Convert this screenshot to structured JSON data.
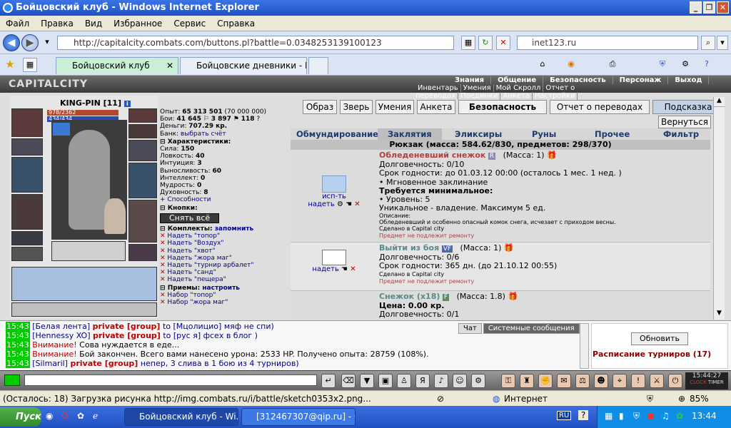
{
  "window": {
    "title": "Бойцовский клуб - Windows Internet Explorer"
  },
  "menu": [
    "Файл",
    "Правка",
    "Вид",
    "Избранное",
    "Сервис",
    "Справка"
  ],
  "address": {
    "url": "http://capitalcity.combats.com/buttons.pl?battle=0.0348253139100123",
    "search": "inet123.ru"
  },
  "tabs": [
    {
      "label": "Бойцовский клуб"
    },
    {
      "label": "Бойцовские дневники - KIN..."
    }
  ],
  "game": {
    "logo": "CAPITALCITY",
    "topnav": [
      "Знания",
      "Общение",
      "Безопасность",
      "Персонаж",
      "Выход"
    ],
    "subnav": [
      "Инвентарь",
      "Умения",
      "Мой Скролл",
      "Отчет о переводах",
      "Поединки",
      "Анкета",
      "Настройки"
    ],
    "char": {
      "name": "KING-PIN",
      "level": "[11]",
      "hp": "978/2362",
      "mana": "434/434"
    },
    "stats": {
      "exp_label": "Опыт:",
      "exp": "65 313 501",
      "exp_next": "(70 000 000)",
      "wins_label": "Бои:",
      "wins": "41 645",
      "losses": "3 897",
      "draws": "118",
      "money_label": "Деньги:",
      "money": "707.29 кр.",
      "bank_label": "Банк:",
      "bank": "выбрать счёт"
    },
    "chars_header": "Характеристики:",
    "attrs": [
      {
        "label": "Сила:",
        "value": "150"
      },
      {
        "label": "Ловкость:",
        "value": "40"
      },
      {
        "label": "Интуиция:",
        "value": "3"
      },
      {
        "label": "Выносливость:",
        "value": "60"
      },
      {
        "label": "Интеллект:",
        "value": "0"
      },
      {
        "label": "Мудрость:",
        "value": "0"
      },
      {
        "label": "Духовность:",
        "value": "8"
      }
    ],
    "abilities": "+ Способности",
    "buttons_header": "Кнопки:",
    "take_off_all": "Снять всё",
    "sets_header": "Комплекты:",
    "remember": "запомнить",
    "sets": [
      "Надеть \"топор\"",
      "Надеть \"Воздух\"",
      "Надеть \"хвот\"",
      "Надеть \"жора маг\"",
      "Надеть \"турнир арбалет\"",
      "Надеть \"санд\"",
      "Надеть \"пещера\""
    ],
    "tricks_header": "Приемы:",
    "configure": "настроить",
    "tricks": [
      "Набор \"топор\"",
      "Набор \"жора маг\""
    ],
    "action_buttons": [
      "Образ",
      "Зверь",
      "Умения",
      "Анкета",
      "Безопасность",
      "Отчет о переводах",
      "Подсказка"
    ],
    "back": "Вернуться",
    "categories": [
      "Обмундирование",
      "Заклятия",
      "Эликсиры",
      "Руны",
      "Прочее",
      "Фильтр"
    ],
    "inv_title": "Рюкзак (масса: 584.62/830, предметов: 298/370)",
    "items": [
      {
        "name": "Обледеневший снежок",
        "badge": "R",
        "mass": "(Масса: 1)",
        "use_label": "исп-ть",
        "wear_label": "надеть",
        "lines": [
          "Долговечность: 0/10",
          "Срок годности: до 01.03.12 00:00 (осталось 1 мес. 1 нед. )",
          "• Мгновенное заклинание"
        ],
        "req_header": "Требуется минимальное:",
        "req": [
          "• Уровень: 5"
        ],
        "unique": "Уникальное - владение. Максимум 5 ед.",
        "desc_label": "Описание:",
        "desc": "Обледеневший и особенно опасный комок снега, исчезает с приходом весны.",
        "made": "Сделано в Capital city",
        "norepair": "Предмет не подлежит ремонту"
      },
      {
        "name": "Выйти из боя",
        "badge": "VF",
        "mass": "(Масса: 1)",
        "wear_label": "надеть",
        "lines": [
          "Долговечность: 0/6",
          "Срок годности: 365 дн. (до 21.10.12 00:55)"
        ],
        "made": "Сделано в Capital city",
        "norepair": "Предмет не подлежит ремонту"
      },
      {
        "name": "Снежок (x18)",
        "badge": "F",
        "mass": "(Масса: 1.8)",
        "price": "Цена: 0.00 кр.",
        "lines": [
          "Долговечность: 0/1"
        ]
      }
    ]
  },
  "chat": {
    "tabs": [
      "Чат",
      "Системные сообщения"
    ],
    "lines": [
      {
        "time": "15:43",
        "name": "[Белая лента]",
        "mode": "private [group]",
        "rest": "to [Мцолицио] мяф не спи)"
      },
      {
        "time": "15:43",
        "name": "[Hennessy XO]",
        "mode": "private [group]",
        "rest": "to [рус я] фсех в блог )"
      },
      {
        "time": "15:43",
        "warn": "Внимание!",
        "rest": "Сова нуждается в еде..."
      },
      {
        "time": "15:43",
        "warn": "Внимание!",
        "rest": "Бой закончен. Всего вами нанесено урона: 2533 HP. Получено опыта: 28759 (108%)."
      },
      {
        "time": "15:43",
        "name": "[Silmaril]",
        "mode": "private [group]",
        "rest": "непер, 3 слива в 1 бою из 4 турниров)"
      }
    ],
    "refresh": "Обновить",
    "schedule": "Расписание турниров (17)",
    "clock": "15:44:27",
    "clock_label": "CLOCK",
    "timer_label": "TIMER"
  },
  "status": {
    "text": "(Осталось: 18) Загрузка рисунка http://img.combats.ru/i/battle/sketch0353x2.png...",
    "zone": "Интернет",
    "zoom": "85%"
  },
  "taskbar": {
    "start": "Пуск",
    "tasks": [
      "Бойцовский клуб - Wi...",
      "[312467307@qip.ru] - О..."
    ],
    "lang": "RU",
    "time": "13:44"
  },
  "colors": {
    "title_blue": "#2458c6",
    "tab_green": "#c9f0d6",
    "chat_time_green": "#00cc00",
    "private_red": "#bb0000"
  }
}
